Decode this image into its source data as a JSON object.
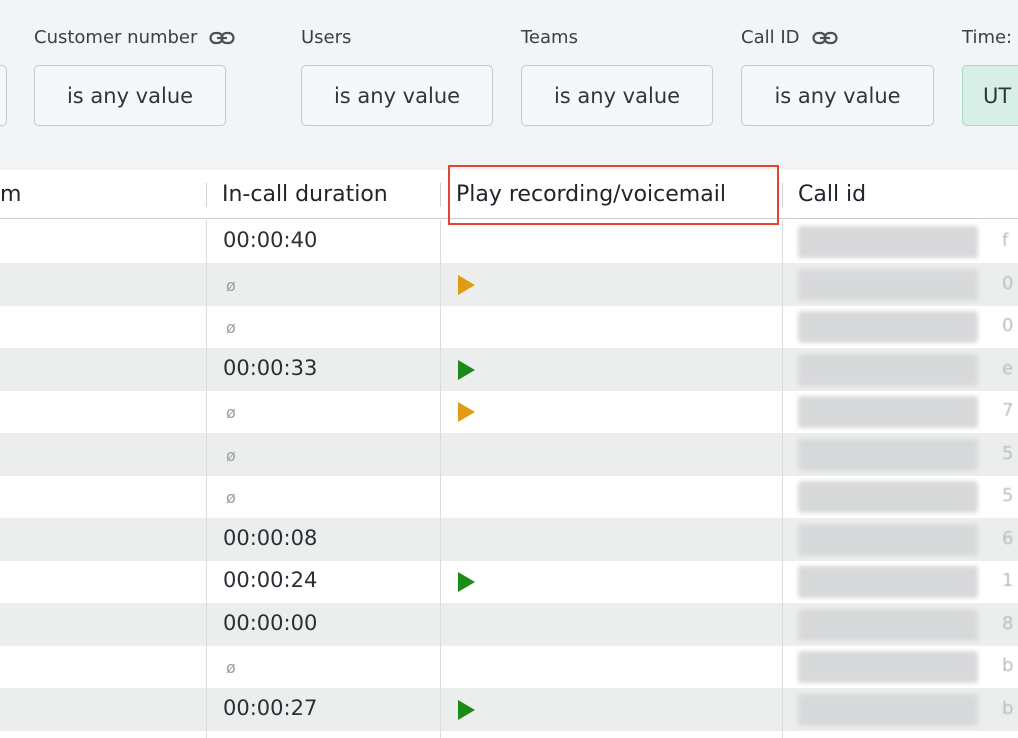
{
  "filters": [
    {
      "label": "Customer number",
      "value": "is any value",
      "linked": true
    },
    {
      "label": "Users",
      "value": "is any value",
      "linked": false
    },
    {
      "label": "Teams",
      "value": "is any value",
      "linked": false
    },
    {
      "label": "Call ID",
      "value": "is any value",
      "linked": true
    },
    {
      "label": "Time:",
      "value": "UT",
      "linked": false
    }
  ],
  "columns": {
    "from_partial": "m",
    "duration": "In-call duration",
    "recording": "Play recording/voicemail",
    "call_id": "Call id"
  },
  "highlight": {
    "column": "recording",
    "color": "#e2452f"
  },
  "rows": [
    {
      "duration": "00:00:40",
      "play": "none",
      "tail": "f"
    },
    {
      "duration": "ø",
      "play": "voicemail",
      "tail": "0"
    },
    {
      "duration": "ø",
      "play": "none",
      "tail": "0"
    },
    {
      "duration": "00:00:33",
      "play": "recording",
      "tail": "e"
    },
    {
      "duration": "ø",
      "play": "voicemail",
      "tail": "7"
    },
    {
      "duration": "ø",
      "play": "none",
      "tail": "5"
    },
    {
      "duration": "ø",
      "play": "none",
      "tail": "5"
    },
    {
      "duration": "00:00:08",
      "play": "none",
      "tail": "6"
    },
    {
      "duration": "00:00:24",
      "play": "recording",
      "tail": "1"
    },
    {
      "duration": "00:00:00",
      "play": "none",
      "tail": "8"
    },
    {
      "duration": "ø",
      "play": "none",
      "tail": "b"
    },
    {
      "duration": "00:00:27",
      "play": "recording",
      "tail": "b"
    }
  ],
  "colors": {
    "recording": "#1a8a1a",
    "voicemail": "#e09a14",
    "timezone_bg": "#d7efe6"
  },
  "icons": {
    "linked_filter": "link-icon",
    "recording": "play-icon",
    "voicemail": "play-icon"
  }
}
